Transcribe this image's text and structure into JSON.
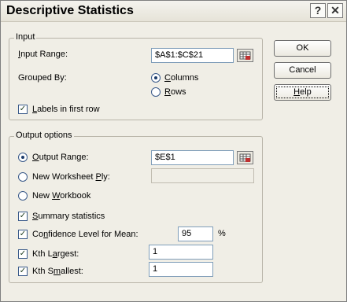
{
  "window": {
    "title": "Descriptive Statistics"
  },
  "titlebar_buttons": {
    "help_glyph": "?",
    "close_glyph": "✕"
  },
  "input_group": {
    "legend": "Input",
    "input_range_label": "Input Range:",
    "input_range_value": "$A$1:$C$21",
    "grouped_by_label": "Grouped By:",
    "columns_label": "Columns",
    "rows_label": "Rows",
    "grouped_by_selected": "Columns",
    "labels_first_row_label": "Labels in first row",
    "labels_first_row_checked": true
  },
  "buttons": {
    "ok": "OK",
    "cancel": "Cancel",
    "help": "Help"
  },
  "output_group": {
    "legend": "Output options",
    "output_range_label": "Output Range:",
    "output_range_value": "$E$1",
    "new_worksheet_label": "New Worksheet Ply:",
    "new_worksheet_value": "",
    "new_workbook_label": "New Workbook",
    "selected_option": "Output Range",
    "summary_statistics_label": "Summary statistics",
    "summary_statistics_checked": true,
    "confidence_label": "Confidence Level for Mean:",
    "confidence_checked": true,
    "confidence_value": "95",
    "confidence_unit": "%",
    "kth_largest_label": "Kth Largest:",
    "kth_largest_checked": true,
    "kth_largest_value": "1",
    "kth_smallest_label": "Kth Smallest:",
    "kth_smallest_checked": true,
    "kth_smallest_value": "1"
  },
  "icons": {
    "help": "help-icon",
    "close": "close-icon",
    "range_selector": "range-selector-icon",
    "checkmark": "checkmark-icon"
  }
}
